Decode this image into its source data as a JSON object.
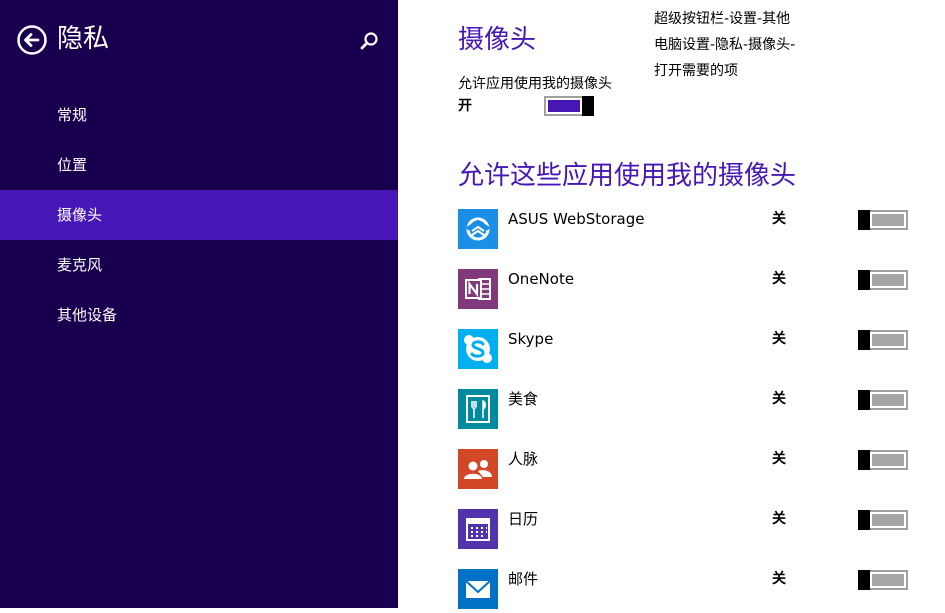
{
  "sidebar": {
    "title": "隐私",
    "items": [
      {
        "label": "常规",
        "active": false
      },
      {
        "label": "位置",
        "active": false
      },
      {
        "label": "摄像头",
        "active": true
      },
      {
        "label": "麦克风",
        "active": false
      },
      {
        "label": "其他设备",
        "active": false
      }
    ]
  },
  "main": {
    "title": "摄像头",
    "note": "超级按钮栏-设置-其他电脑设置-隐私-摄像头-打开需要的项",
    "allow_label": "允许应用使用我的摄像头",
    "allow_state": "开",
    "apps_title": "允许这些应用使用我的摄像头",
    "apps": [
      {
        "name": "ASUS WebStorage",
        "state": "关",
        "icon": "asus-webstorage-icon",
        "color": "#1b8fe6"
      },
      {
        "name": "OneNote",
        "state": "关",
        "icon": "onenote-icon",
        "color": "#80397b"
      },
      {
        "name": "Skype",
        "state": "关",
        "icon": "skype-icon",
        "color": "#00aff0"
      },
      {
        "name": "美食",
        "state": "关",
        "icon": "food-icon",
        "color": "#008a9e"
      },
      {
        "name": "人脉",
        "state": "关",
        "icon": "people-icon",
        "color": "#d24726"
      },
      {
        "name": "日历",
        "state": "关",
        "icon": "calendar-icon",
        "color": "#5133ab"
      },
      {
        "name": "邮件",
        "state": "关",
        "icon": "mail-icon",
        "color": "#0072c6"
      }
    ]
  },
  "colors": {
    "sidebar_bg": "#18004f",
    "accent": "#4617b4"
  }
}
